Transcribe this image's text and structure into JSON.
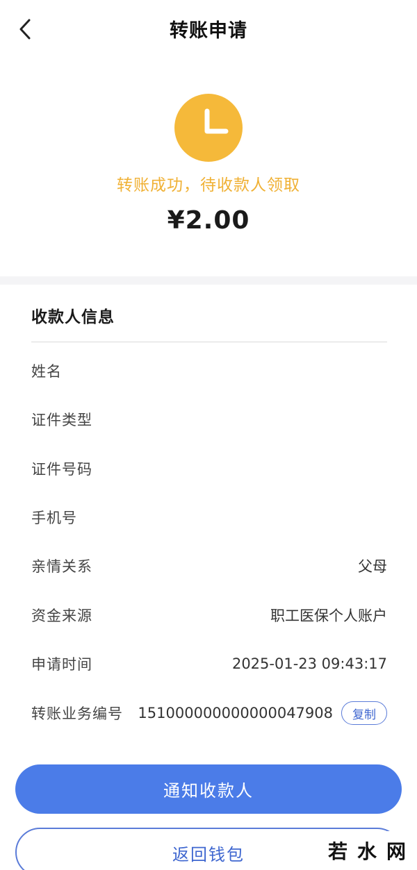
{
  "header": {
    "title": "转账申请"
  },
  "status": {
    "icon": "clock-icon",
    "text": "转账成功，待收款人领取",
    "amount": "¥2.00",
    "color": "#f5b93a"
  },
  "payee": {
    "section_title": "收款人信息",
    "rows": [
      {
        "label": "姓名",
        "value": ""
      },
      {
        "label": "证件类型",
        "value": ""
      },
      {
        "label": "证件号码",
        "value": ""
      },
      {
        "label": "手机号",
        "value": ""
      },
      {
        "label": "亲情关系",
        "value": "父母"
      },
      {
        "label": "资金来源",
        "value": "职工医保个人账户"
      },
      {
        "label": "申请时间",
        "value": "2025-01-23 09:43:17"
      },
      {
        "label": "转账业务编号",
        "value": "151000000000000047908"
      }
    ],
    "copy_label": "复制"
  },
  "actions": {
    "notify_label": "通知收款人",
    "back_wallet_label": "返回钱包",
    "accent": "#4b7ce8"
  },
  "watermark": {
    "text": "若水网"
  }
}
